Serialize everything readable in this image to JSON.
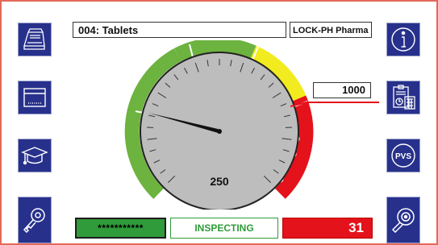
{
  "header": {
    "product_label": "004: Tablets",
    "customer_label": "LOCK-PH Pharma"
  },
  "gauge": {
    "value_label": "250",
    "value": 250,
    "limit_label": "1000",
    "zones": [
      "green",
      "yellow",
      "red"
    ],
    "colors": {
      "green": "#6db33f",
      "yellow": "#f2eb1f",
      "red": "#e4121b",
      "dial": "#bdbdbd"
    }
  },
  "footer": {
    "code_label": "***********",
    "status_label": "INSPECTING",
    "count_label": "31"
  },
  "sidebar_left": [
    "printer-icon",
    "box-icon",
    "graduation-cap-icon",
    "key-icon"
  ],
  "sidebar_right": [
    "info-icon",
    "report-icon",
    "pvs-icon",
    "search-icon"
  ],
  "sidebar_right_labels": {
    "pvs": "PVS"
  },
  "colors": {
    "button_bg": "#27318c",
    "frame": "#e36a5a"
  }
}
